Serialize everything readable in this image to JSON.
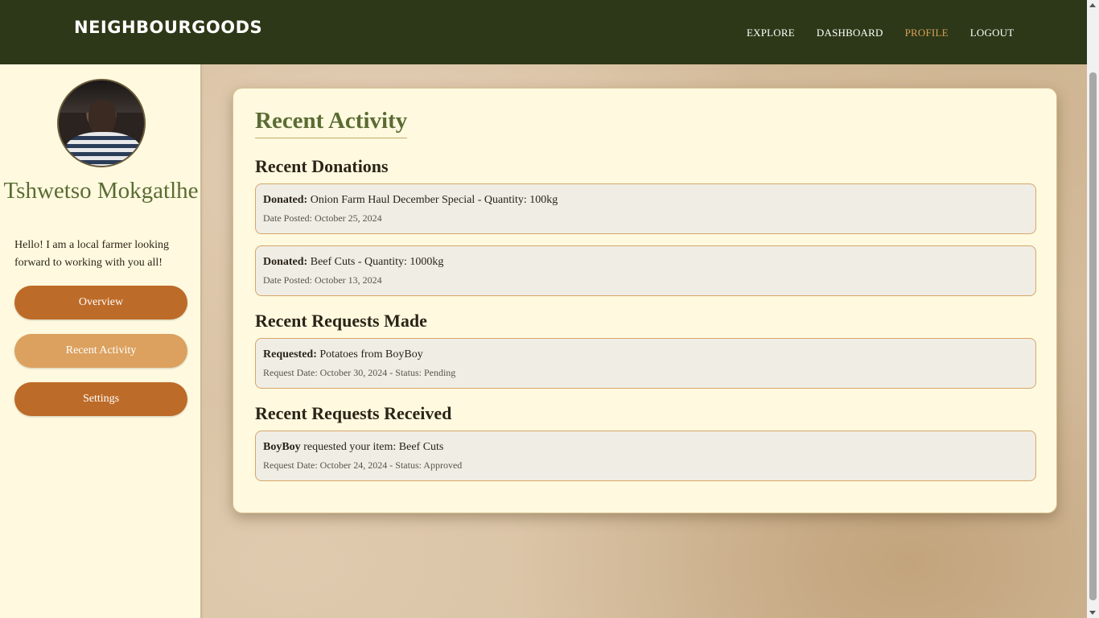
{
  "header": {
    "brand": "NEIGHBOURGOODS",
    "nav": [
      {
        "label": "EXPLORE"
      },
      {
        "label": "DASHBOARD"
      },
      {
        "label": "PROFILE",
        "active": true
      },
      {
        "label": "LOGOUT"
      }
    ]
  },
  "sidebar": {
    "avatar_icon": "user-avatar-photo",
    "name": "Tshwetso Mokgatlhe",
    "bio": "Hello! I am a local farmer looking forward to working with you all!",
    "buttons": [
      {
        "label": "Overview"
      },
      {
        "label": "Recent Activity",
        "active": true
      },
      {
        "label": "Settings"
      }
    ]
  },
  "main": {
    "title": "Recent Activity",
    "donations": {
      "heading": "Recent Donations",
      "items": [
        {
          "prefix": "Donated:",
          "text": "Onion Farm Haul December Special - Quantity: 100kg",
          "meta": "Date Posted: October 25, 2024"
        },
        {
          "prefix": "Donated:",
          "text": "Beef Cuts - Quantity: 1000kg",
          "meta": "Date Posted: October 13, 2024"
        }
      ]
    },
    "requests_made": {
      "heading": "Recent Requests Made",
      "items": [
        {
          "prefix": "Requested:",
          "text": "Potatoes from BoyBoy",
          "meta": "Request Date: October 30, 2024 - Status: Pending"
        }
      ]
    },
    "requests_received": {
      "heading": "Recent Requests Received",
      "items": [
        {
          "prefix": "BoyBoy",
          "text": "requested your item: Beef Cuts",
          "meta": "Request Date: October 24, 2024 - Status: Approved"
        }
      ]
    }
  },
  "colors": {
    "header_bg": "#2c3817",
    "accent_active": "#d9a05b",
    "button": "#bd6b28",
    "button_active": "#dca15f",
    "title_green": "#5a6b33",
    "card_bg": "#fffadf"
  }
}
